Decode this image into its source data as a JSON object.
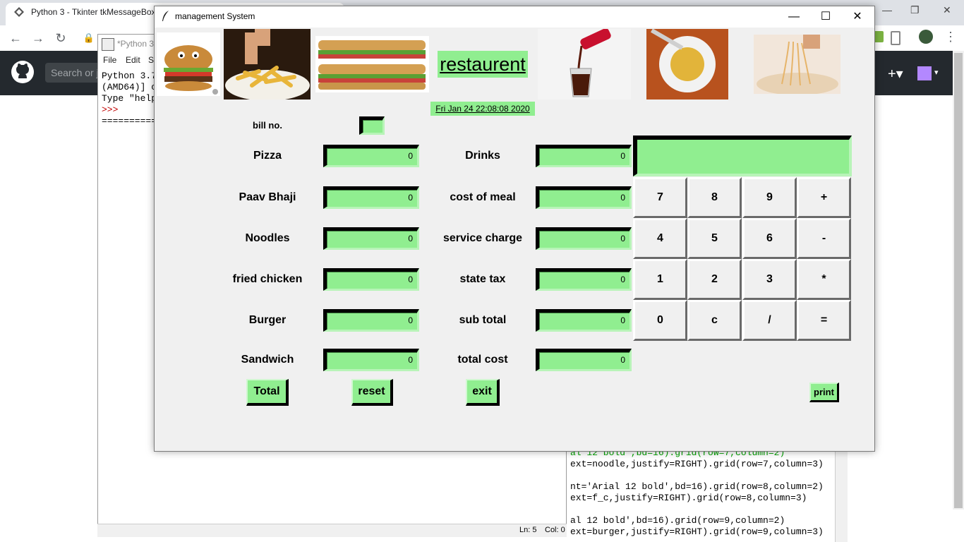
{
  "browser": {
    "tab_title": "Python 3 - Tkinter tkMessageBox",
    "search_placeholder": "Search or j"
  },
  "idle": {
    "title": "*Python 3",
    "menu": [
      "File",
      "Edit",
      "S"
    ],
    "lines": [
      "Python 3.7",
      "(AMD64)] o",
      "Type \"help",
      ">>>",
      "=========="
    ],
    "status_ln": "Ln: 5",
    "status_col": "Col: 0"
  },
  "editor_code": [
    "al 12 bold',bd=16).grid(row=7,column=2)",
    "ext=noodle,justify=RIGHT).grid(row=7,column=3)",
    "nt='Arial 12 bold',bd=16).grid(row=8,column=2)",
    "ext=f_c,justify=RIGHT).grid(row=8,column=3)",
    "al 12 bold',bd=16).grid(row=9,column=2)",
    "ext=burger,justify=RIGHT).grid(row=9,column=3)"
  ],
  "window": {
    "title": "management System"
  },
  "header": {
    "title": "restaurent",
    "datetime": "Fri Jan 24 22:08:08 2020"
  },
  "bill": {
    "label": "bill no.",
    "value": ""
  },
  "left_items": [
    {
      "label": "Pizza",
      "value": "0"
    },
    {
      "label": "Paav Bhaji",
      "value": "0"
    },
    {
      "label": "Noodles",
      "value": "0"
    },
    {
      "label": "fried chicken",
      "value": "0"
    },
    {
      "label": "Burger",
      "value": "0"
    },
    {
      "label": "Sandwich",
      "value": "0"
    }
  ],
  "right_items": [
    {
      "label": "Drinks",
      "value": "0"
    },
    {
      "label": "cost of meal",
      "value": "0"
    },
    {
      "label": "service charge",
      "value": "0"
    },
    {
      "label": "state tax",
      "value": "0"
    },
    {
      "label": "sub total",
      "value": "0"
    },
    {
      "label": "total cost",
      "value": "0"
    }
  ],
  "calculator": {
    "display": "",
    "keys": [
      "7",
      "8",
      "9",
      "+",
      "4",
      "5",
      "6",
      "-",
      "1",
      "2",
      "3",
      "*",
      "0",
      "c",
      "/",
      "="
    ]
  },
  "buttons": {
    "total": "Total",
    "reset": "reset",
    "exit": "exit",
    "print": "print"
  },
  "images": [
    "burger-image",
    "fries-image",
    "sandwich-image",
    "cola-image",
    "soup-image",
    "noodles-image"
  ],
  "colors": {
    "accent_green": "#90ee90",
    "window_bg": "#f0f0f0",
    "github_header": "#24292e"
  }
}
